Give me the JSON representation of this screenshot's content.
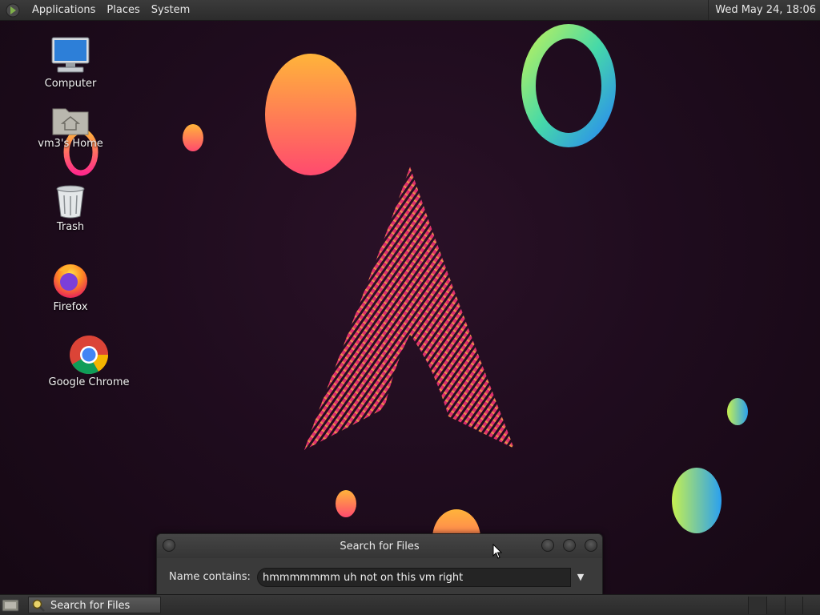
{
  "top_panel": {
    "menus": [
      "Applications",
      "Places",
      "System"
    ],
    "clock": "Wed May 24, 18:06"
  },
  "desktop_icons": [
    {
      "label": "Computer",
      "icon": "computer-icon"
    },
    {
      "label": "vm3's Home",
      "icon": "home-folder-icon"
    },
    {
      "label": "Trash",
      "icon": "trash-icon"
    },
    {
      "label": "Firefox",
      "icon": "firefox-icon"
    },
    {
      "label": "Google Chrome",
      "icon": "chrome-icon"
    }
  ],
  "dialog": {
    "title": "Search for Files",
    "name_contains_label": "Name contains:",
    "name_contains_value": "hmmmmmmm uh not on this vm right"
  },
  "taskbar": {
    "task_label": "Search for Files"
  },
  "colors": {
    "panel": "#2e2e2e",
    "wallpaper": "#1e0b1d",
    "arch_logo_pink": "#e8286e",
    "arch_logo_yellow": "#f7c23a"
  }
}
